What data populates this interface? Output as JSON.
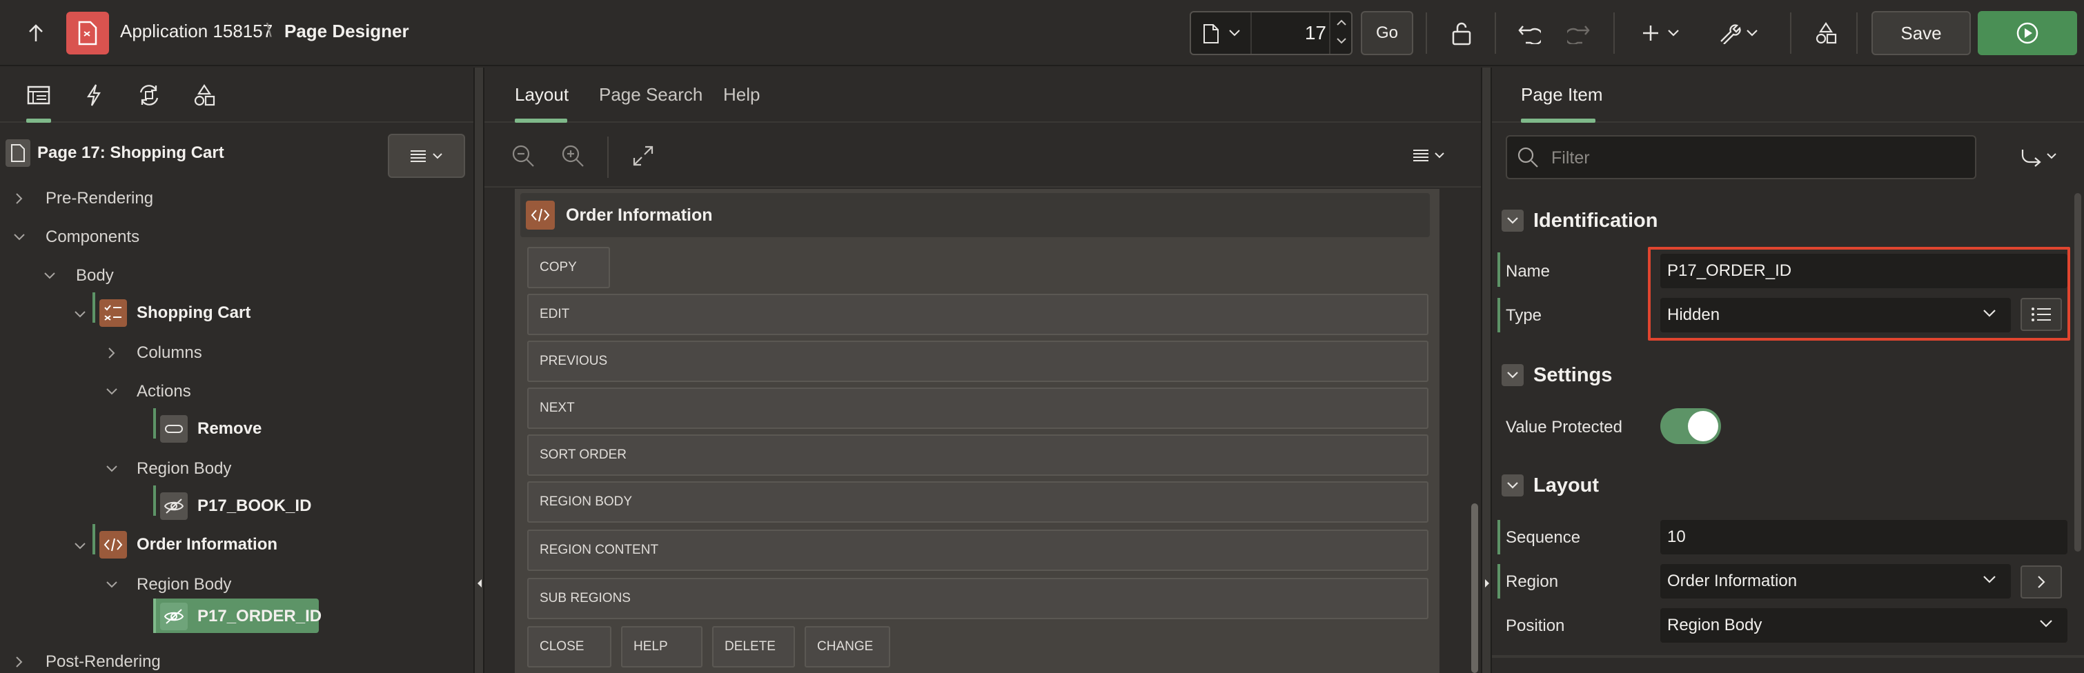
{
  "header": {
    "app_name": "Application 158157",
    "separator": "\\",
    "title": "Page Designer",
    "page_number": "17",
    "go_label": "Go",
    "save_label": "Save"
  },
  "left_panel": {
    "tabs": [
      "rendering-tree",
      "dynamic-actions",
      "processing",
      "shared-components"
    ],
    "tree": {
      "root": "Page 17: Shopping Cart",
      "pre_rendering": "Pre-Rendering",
      "components": "Components",
      "body": "Body",
      "shopping_cart": "Shopping Cart",
      "columns": "Columns",
      "actions": "Actions",
      "remove": "Remove",
      "region_body_1": "Region Body",
      "book_id": "P17_BOOK_ID",
      "order_information": "Order Information",
      "region_body_2": "Region Body",
      "order_id": "P17_ORDER_ID",
      "post_rendering": "Post-Rendering"
    }
  },
  "center_panel": {
    "tabs": [
      "Layout",
      "Page Search",
      "Help"
    ],
    "active_tab": "Layout",
    "region_title": "Order Information",
    "positions": {
      "copy": "COPY",
      "edit": "EDIT",
      "previous": "PREVIOUS",
      "next": "NEXT",
      "sort_order": "SORT ORDER",
      "region_body": "REGION BODY",
      "region_content": "REGION CONTENT",
      "sub_regions": "SUB REGIONS",
      "close": "CLOSE",
      "help": "HELP",
      "delete": "DELETE",
      "change": "CHANGE"
    }
  },
  "right_panel": {
    "tab": "Page Item",
    "filter_placeholder": "Filter",
    "identification": {
      "title": "Identification",
      "name_label": "Name",
      "name_value": "P17_ORDER_ID",
      "type_label": "Type",
      "type_value": "Hidden"
    },
    "settings": {
      "title": "Settings",
      "value_protected_label": "Value Protected",
      "value_protected": true
    },
    "layout": {
      "title": "Layout",
      "sequence_label": "Sequence",
      "sequence_value": "10",
      "region_label": "Region",
      "region_value": "Order Information",
      "position_label": "Position",
      "position_value": "Region Body"
    }
  },
  "colors": {
    "accent_green": "#5d9467",
    "highlight_red": "#e0452f",
    "app_icon_red": "#d9534f",
    "region_badge": "#9a5a3b"
  }
}
